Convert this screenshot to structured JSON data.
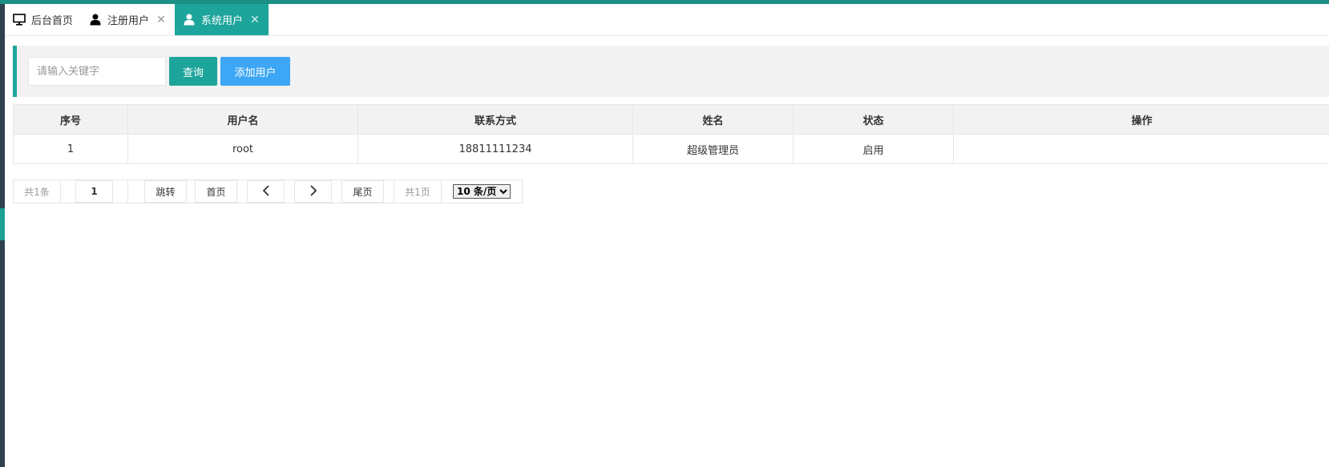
{
  "tabs": [
    {
      "label": "后台首页",
      "icon": "monitor-icon",
      "closable": false,
      "active": false
    },
    {
      "label": "注册用户",
      "icon": "user-icon",
      "closable": true,
      "active": false
    },
    {
      "label": "系统用户",
      "icon": "user-icon",
      "closable": true,
      "active": true
    }
  ],
  "toolbar": {
    "search_placeholder": "请输入关键字",
    "query_label": "查询",
    "add_label": "添加用户"
  },
  "table": {
    "headers": [
      "序号",
      "用户名",
      "联系方式",
      "姓名",
      "状态",
      "操作"
    ],
    "rows": [
      [
        "1",
        "root",
        "18811111234",
        "超级管理员",
        "启用",
        ""
      ]
    ]
  },
  "pager": {
    "total_label": "共1条",
    "page_value": "1",
    "jump_label": "跳转",
    "first_label": "首页",
    "prev_icon": "chevron-left-icon",
    "next_icon": "chevron-right-icon",
    "last_label": "尾页",
    "pages_label": "共1页",
    "page_size_selected": "10 条/页"
  },
  "colors": {
    "accent": "#1ea59b",
    "add_button": "#3da6f5",
    "frame_top": "#1e8f86"
  },
  "tab_close_glyph": "✕"
}
